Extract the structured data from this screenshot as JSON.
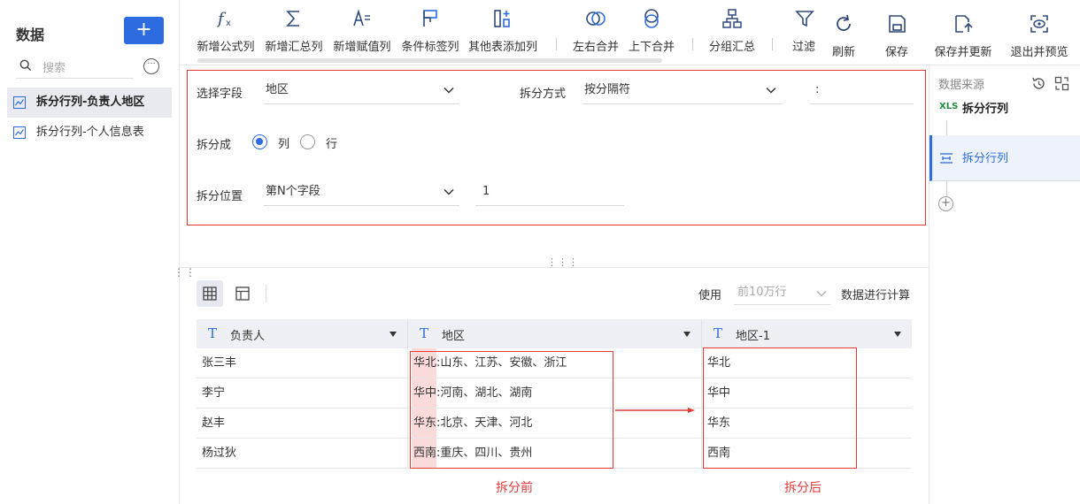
{
  "sidebar": {
    "title": "数据",
    "add_label": "+",
    "search_placeholder": "搜索",
    "items": [
      {
        "label": "拆分行列-负责人地区",
        "active": true
      },
      {
        "label": "拆分行列-个人信息表",
        "active": false
      }
    ]
  },
  "toolbar": {
    "buttons": [
      {
        "label": "新增公式列",
        "icon": "formula-icon"
      },
      {
        "label": "新增汇总列",
        "icon": "sigma-icon"
      },
      {
        "label": "新增赋值列",
        "icon": "assign-icon"
      },
      {
        "label": "条件标签列",
        "icon": "flag-icon"
      },
      {
        "label": "其他表添加列",
        "icon": "add-column-icon"
      },
      {
        "label": "左右合并",
        "icon": "merge-lr-icon"
      },
      {
        "label": "上下合并",
        "icon": "merge-tb-icon"
      },
      {
        "label": "分组汇总",
        "icon": "group-icon"
      },
      {
        "label": "过滤",
        "icon": "filter-icon"
      },
      {
        "label": "刷新",
        "icon": "refresh-icon"
      },
      {
        "label": "保存",
        "icon": "save-icon"
      },
      {
        "label": "保存并更新",
        "icon": "save-update-icon"
      },
      {
        "label": "退出并预览",
        "icon": "preview-icon"
      }
    ]
  },
  "settings": {
    "field_label": "选择字段",
    "field_value": "地区",
    "method_label": "拆分方式",
    "method_value": "按分隔符",
    "separator_value": ":",
    "split_into_label": "拆分成",
    "option_col": "列",
    "option_row": "行",
    "selected_option": "列",
    "position_label": "拆分位置",
    "position_value": "第N个字段",
    "n_value": "1"
  },
  "usage": {
    "prefix": "使用",
    "selected": "前10万行",
    "suffix": "数据进行计算"
  },
  "table": {
    "columns": [
      "负责人",
      "地区",
      "地区-1"
    ],
    "column_type_icon": "T",
    "rows": [
      [
        "张三丰",
        "华北:山东、江苏、安徽、浙江",
        "华北"
      ],
      [
        "李宁",
        "华中:河南、湖北、湖南",
        "华中"
      ],
      [
        "赵丰",
        "华东:北京、天津、河北",
        "华东"
      ],
      [
        "杨过狄",
        "西南:重庆、四川、贵州",
        "西南"
      ]
    ]
  },
  "captions": {
    "before": "拆分前",
    "after": "拆分后"
  },
  "right_panel": {
    "title": "数据来源",
    "source_badge": "XLS",
    "source_name": "拆分行列",
    "step_name": "拆分行列"
  },
  "colors": {
    "accent": "#2c6ce0",
    "highlight_border": "#e53935",
    "highlight_fill": "#fbdada"
  }
}
